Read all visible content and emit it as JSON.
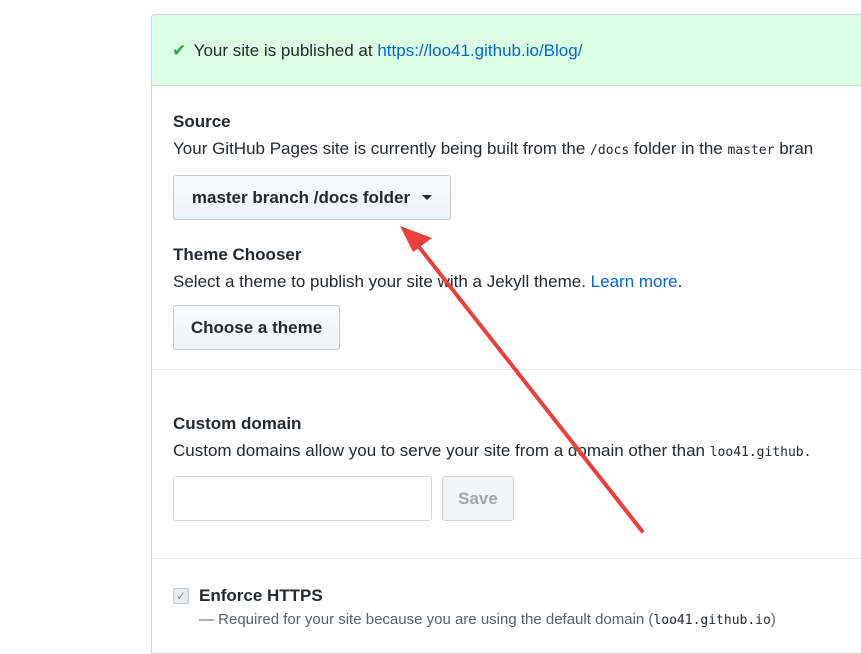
{
  "flash": {
    "check_icon": "check-icon",
    "text": "Your site is published at",
    "url": "https://loo41.github.io/Blog/"
  },
  "source": {
    "heading": "Source",
    "desc_before": "Your GitHub Pages site is currently being built from the",
    "docs_code": "/docs",
    "desc_middle": "folder in the",
    "branch_code": "master",
    "desc_after": "bran",
    "dropdown_label": "master branch /docs folder"
  },
  "theme": {
    "heading": "Theme Chooser",
    "desc": "Select a theme to publish your site with a Jekyll theme.",
    "learn_more": "Learn more",
    "period": ".",
    "button_label": "Choose a theme"
  },
  "custom_domain": {
    "heading": "Custom domain",
    "desc": "Custom domains allow you to serve your site from a domain other than",
    "domain_code": "loo41.github.",
    "input_value": "",
    "save_label": "Save"
  },
  "https": {
    "label": "Enforce HTTPS",
    "checked": true,
    "note_before": "— Required for your site because you are using the default domain (",
    "note_code": "loo41.github.io",
    "note_after": ")"
  },
  "annotation": {
    "arrow_color": "#e8403a"
  }
}
